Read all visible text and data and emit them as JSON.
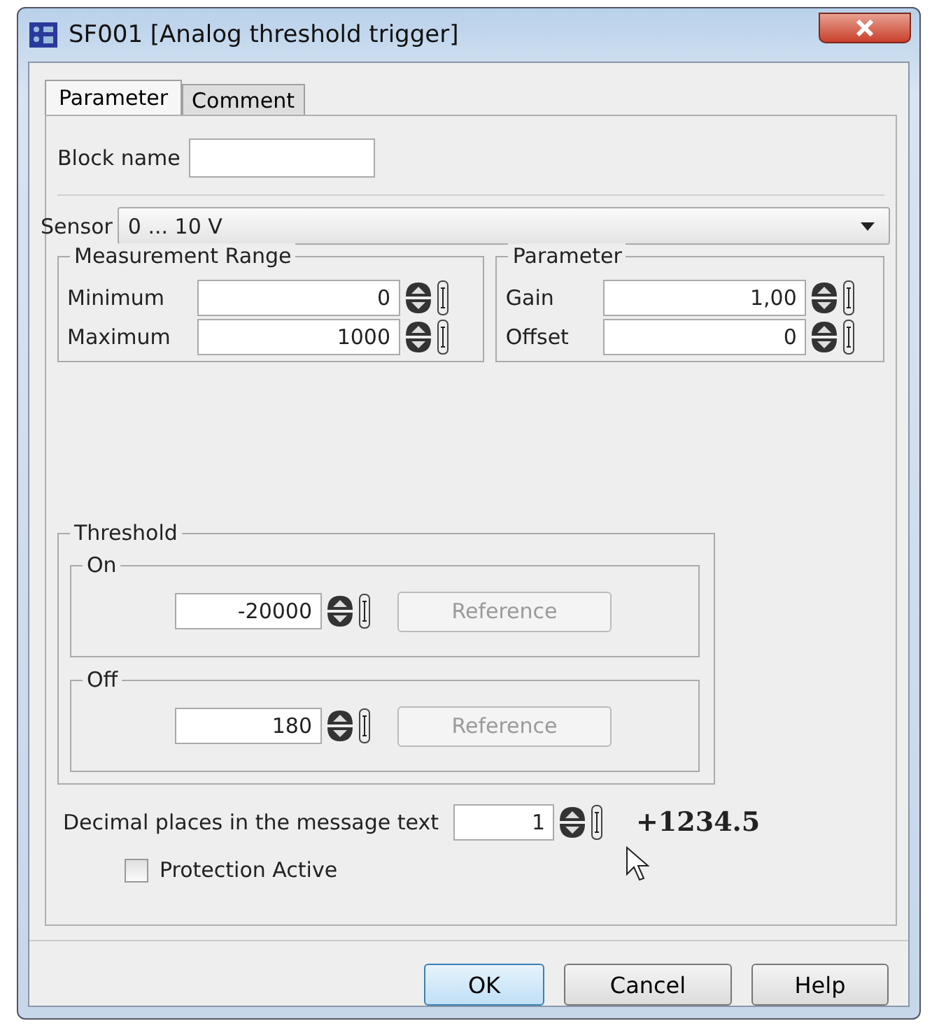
{
  "window": {
    "title": "SF001 [Analog threshold trigger]"
  },
  "tabs": [
    {
      "label": "Parameter",
      "selected": true
    },
    {
      "label": "Comment",
      "selected": false
    }
  ],
  "block_name": {
    "label": "Block name"
  },
  "sensor": {
    "label": "Sensor",
    "value": "0 ... 10 V"
  },
  "groups": [
    {
      "title": "Measurement Range",
      "fields": [
        {
          "label": "Minimum",
          "value": "0"
        },
        {
          "label": "Maximum",
          "value": "1000"
        }
      ]
    },
    {
      "title": "Parameter",
      "fields": [
        {
          "label": "Gain",
          "value": "1,00"
        },
        {
          "label": "Offset",
          "value": "0"
        }
      ]
    }
  ],
  "threshold": {
    "title": "Threshold",
    "parts": [
      {
        "title": "On",
        "value": "-20000",
        "button": "Reference",
        "disabled": true
      },
      {
        "title": "Off",
        "value": "180",
        "button": "Reference",
        "disabled": true
      }
    ]
  },
  "decimal_places": {
    "label": "Decimal places in the message text",
    "value": "1",
    "preview": "+1234.5"
  },
  "protection": {
    "label": "Protection Active",
    "checked": false
  },
  "buttons": [
    {
      "label": "OK",
      "default": true
    },
    {
      "label": "Cancel",
      "default": false
    },
    {
      "label": "Help",
      "default": false
    }
  ]
}
